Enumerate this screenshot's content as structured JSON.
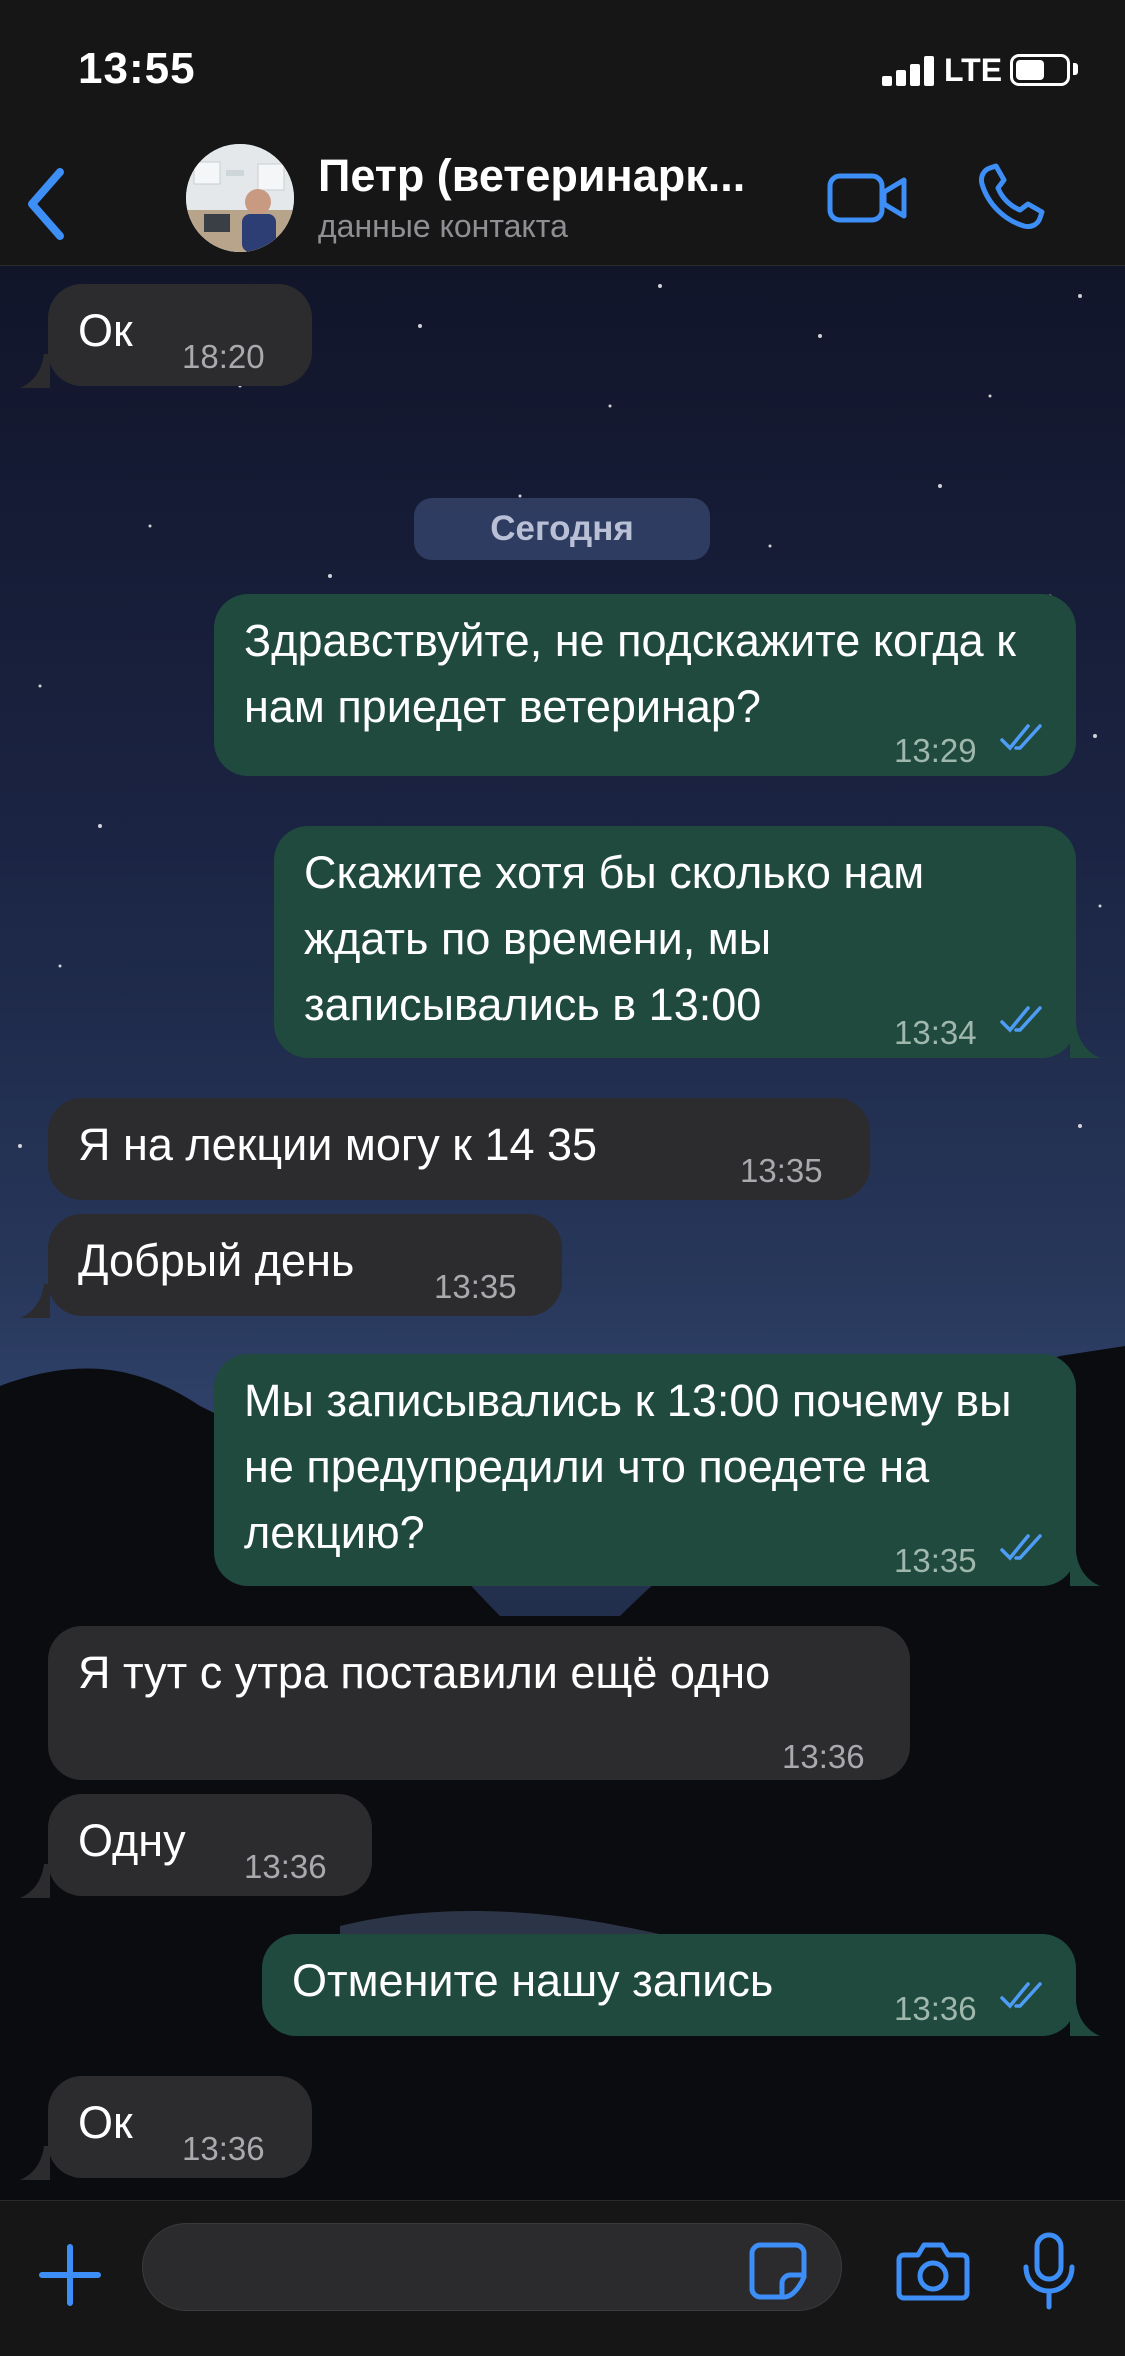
{
  "status_bar": {
    "time": "13:55",
    "network": "LTE"
  },
  "header": {
    "back_icon": "chevron-left-icon",
    "contact_name": "Петр (ветеринарк...",
    "contact_subtitle": "данные контакта",
    "video_icon": "video-camera-icon",
    "call_icon": "phone-icon"
  },
  "date_separator": "Сегодня",
  "messages": [
    {
      "dir": "in",
      "text": "Ок",
      "time": "18:20"
    },
    {
      "dir": "out",
      "text": "Здравствуйте, не подскажите когда к нам приедет ветеринар?",
      "time": "13:29"
    },
    {
      "dir": "out",
      "text": "Скажите хотя бы сколько нам ждать по времени, мы записывались в 13:00",
      "time": "13:34"
    },
    {
      "dir": "in",
      "text": "Я на лекции могу к 14 35",
      "time": "13:35"
    },
    {
      "dir": "in",
      "text": "Добрый день",
      "time": "13:35"
    },
    {
      "dir": "out",
      "text": "Мы записывались к 13:00 почему вы не предупредили что поедете на лекцию?",
      "time": "13:35"
    },
    {
      "dir": "in",
      "text": "Я тут с утра поставили ещё одно",
      "time": "13:36"
    },
    {
      "dir": "in",
      "text": "Одну",
      "time": "13:36"
    },
    {
      "dir": "out",
      "text": "Отмените нашу запись",
      "time": "13:36"
    },
    {
      "dir": "in",
      "text": "Ок",
      "time": "13:36"
    }
  ],
  "input_bar": {
    "plus_icon": "plus-icon",
    "placeholder": "",
    "sticker_icon": "sticker-icon",
    "camera_icon": "camera-icon",
    "mic_icon": "microphone-icon"
  },
  "colors": {
    "accent": "#3d8ef7",
    "incoming_bubble": "#2c2c2e",
    "outgoing_bubble": "#1f4a3d",
    "read_ticks": "#4f9cf7"
  }
}
